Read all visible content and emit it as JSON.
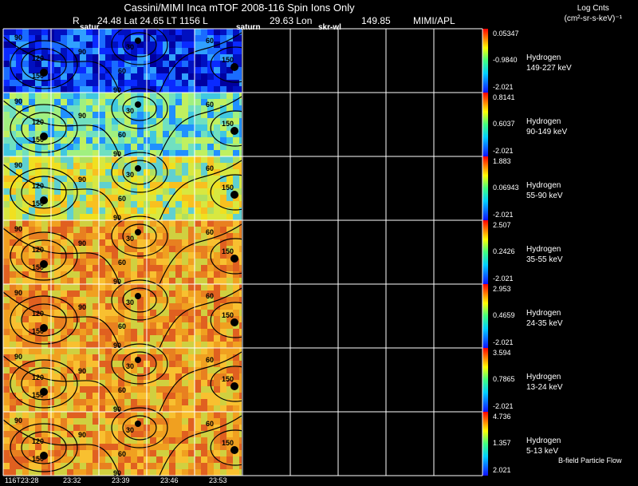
{
  "header": {
    "title": "Cassini/MIMI Inca mTOF  2008-116   Spin   Ions Only",
    "sub_r": "R",
    "sub_lat": "24.48 Lat 24.65 LT 1156 L",
    "sub_lon": "29.63 Lon",
    "sub_val": "149.85",
    "sub_org": "MIMI/APL",
    "colorbar_unit_1": "Log Cnts",
    "colorbar_unit_2": "(cm²-sr-s-keV)⁻¹"
  },
  "markers": [
    "satur",
    "saturn",
    "skr-wl"
  ],
  "panels": [
    {
      "species": "Hydrogen",
      "energy": "149-227 keV",
      "max": "0.05347",
      "mid": "-0.9840",
      "min": "-2.021",
      "scheme": "blue"
    },
    {
      "species": "Hydrogen",
      "energy": "90-149 keV",
      "max": "0.8141",
      "mid": "0.6037",
      "min": "-2.021",
      "scheme": "cyan"
    },
    {
      "species": "Hydrogen",
      "energy": "55-90 keV",
      "max": "1.883",
      "mid": "0.06943",
      "min": "-2.021",
      "scheme": "yellow"
    },
    {
      "species": "Hydrogen",
      "energy": "35-55 keV",
      "max": "2.507",
      "mid": "0.2426",
      "min": "-2.021",
      "scheme": "orange"
    },
    {
      "species": "Hydrogen",
      "energy": "24-35 keV",
      "max": "2.953",
      "mid": "0.4659",
      "min": "-2.021",
      "scheme": "orange"
    },
    {
      "species": "Hydrogen",
      "energy": "13-24 keV",
      "max": "3.594",
      "mid": "0.7865",
      "min": "-2.021",
      "scheme": "orange"
    },
    {
      "species": "Hydrogen",
      "energy": "5-13 keV",
      "max": "4.736",
      "mid": "1.357",
      "min": "2.021",
      "scheme": "orange"
    }
  ],
  "contour_labels": [
    "30",
    "60",
    "90",
    "120",
    "150"
  ],
  "footer": {
    "bfield": "B-field Particle Flow",
    "ticks": [
      "116T23:28",
      "23:32",
      "23:39",
      "23:46",
      "23:53"
    ]
  },
  "colors": {
    "grid": "#ffffff",
    "background": "#000000"
  }
}
